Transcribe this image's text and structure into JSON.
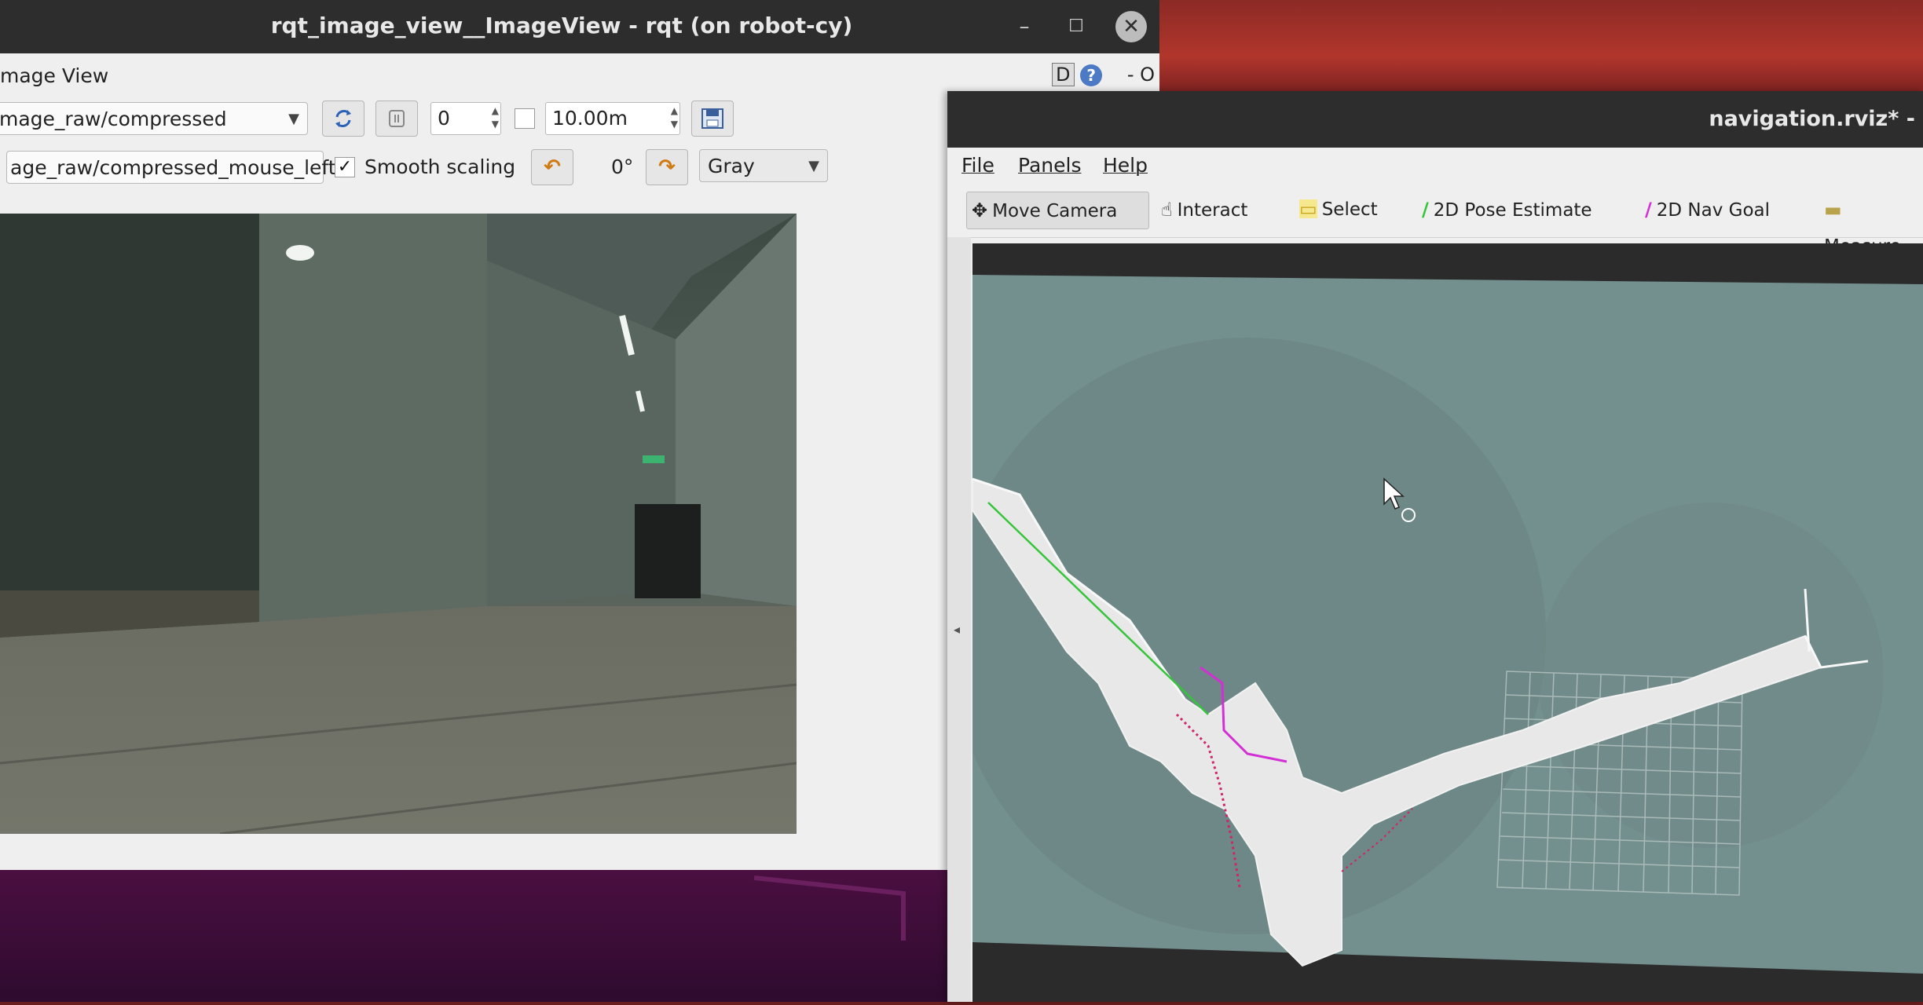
{
  "rqt": {
    "title": "rqt_image_view__ImageView - rqt (on robot-cy)",
    "min_icon": "–",
    "max_icon": "☐",
    "close_icon": "✕",
    "plugin_title": "mage View",
    "d_label": "D",
    "help_icon": "?",
    "extra_controls": "- O",
    "topic": "mage_raw/compressed",
    "refresh_icon": "refresh-icon",
    "frame_value": "0",
    "max_range": "10.00m",
    "mouse_topic": "age_raw/compressed_mouse_left",
    "smooth_scaling_label": "Smooth scaling",
    "smooth_scaling_checked": "✓",
    "rotate_left_icon": "↶",
    "rotation": "0°",
    "rotate_right_icon": "↷",
    "color_scheme": "Gray"
  },
  "rviz": {
    "title": "navigation.rviz* -",
    "menu": [
      "File",
      "Panels",
      "Help"
    ],
    "tools": [
      {
        "label": "Move Camera",
        "icon": "✥"
      },
      {
        "label": "Interact",
        "icon": "☝"
      },
      {
        "label": "Select",
        "icon": "▭"
      },
      {
        "label": "2D Pose Estimate",
        "icon": "/"
      },
      {
        "label": "2D Nav Goal",
        "icon": "/"
      },
      {
        "label": "Measure",
        "icon": "▬"
      }
    ],
    "collapse_icon": "◂"
  },
  "colors": {
    "pose_arrow": "#35c43a",
    "goal_arrow": "#d22fd4",
    "map_bg": "#74908e",
    "free_space": "#e8e8e8"
  }
}
